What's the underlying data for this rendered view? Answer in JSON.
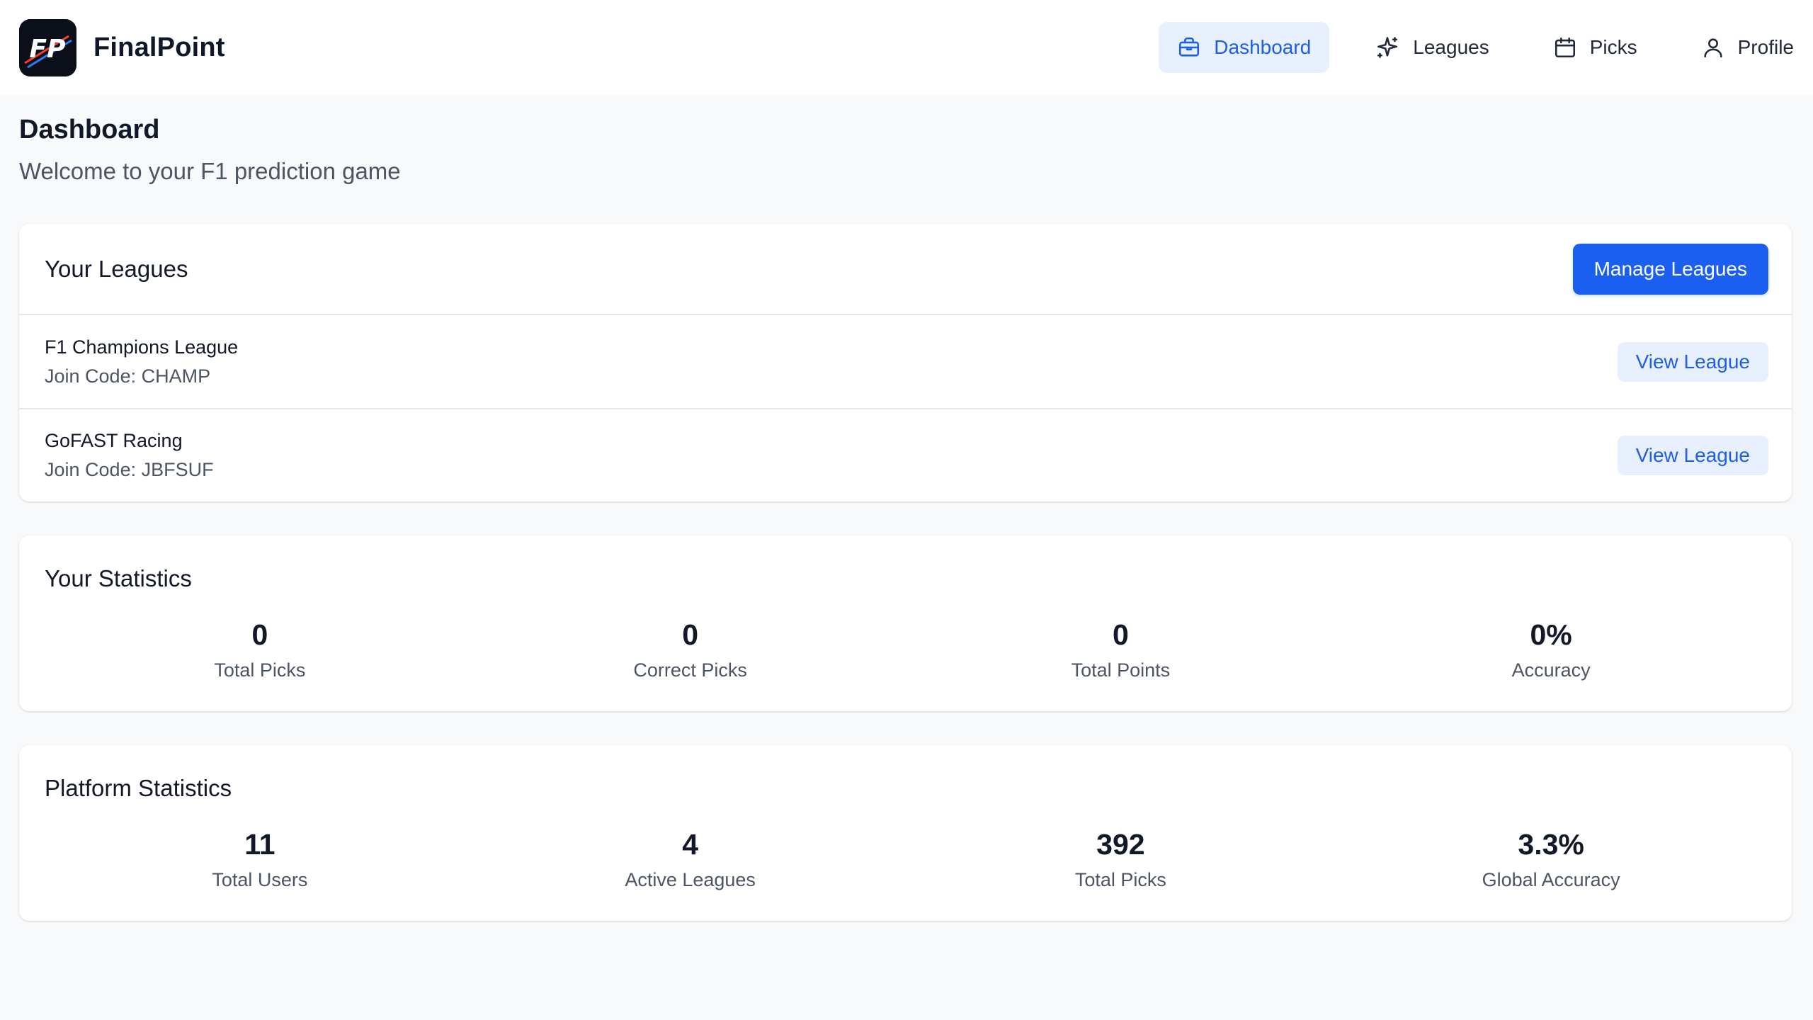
{
  "app": {
    "name": "FinalPoint",
    "logo_text": "FP"
  },
  "nav": {
    "items": [
      {
        "label": "Dashboard",
        "icon": "briefcase-icon",
        "active": true
      },
      {
        "label": "Leagues",
        "icon": "sparkle-icon",
        "active": false
      },
      {
        "label": "Picks",
        "icon": "calendar-icon",
        "active": false
      },
      {
        "label": "Profile",
        "icon": "user-icon",
        "active": false
      }
    ]
  },
  "page": {
    "title": "Dashboard",
    "subtitle": "Welcome to your F1 prediction game"
  },
  "leagues": {
    "title": "Your Leagues",
    "manage_label": "Manage Leagues",
    "items": [
      {
        "name": "F1 Champions League",
        "join_code": "Join Code: CHAMP",
        "action": "View League"
      },
      {
        "name": "GoFAST Racing",
        "join_code": "Join Code: JBFSUF",
        "action": "View League"
      }
    ]
  },
  "your_stats": {
    "title": "Your Statistics",
    "items": [
      {
        "value": "0",
        "label": "Total Picks"
      },
      {
        "value": "0",
        "label": "Correct Picks"
      },
      {
        "value": "0",
        "label": "Total Points"
      },
      {
        "value": "0%",
        "label": "Accuracy"
      }
    ]
  },
  "platform_stats": {
    "title": "Platform Statistics",
    "items": [
      {
        "value": "11",
        "label": "Total Users"
      },
      {
        "value": "4",
        "label": "Active Leagues"
      },
      {
        "value": "392",
        "label": "Total Picks"
      },
      {
        "value": "3.3%",
        "label": "Global Accuracy"
      }
    ]
  },
  "colors": {
    "primary": "#1a5ff0",
    "active_nav_bg": "#e8f0fe",
    "background": "#f8f9fb"
  }
}
